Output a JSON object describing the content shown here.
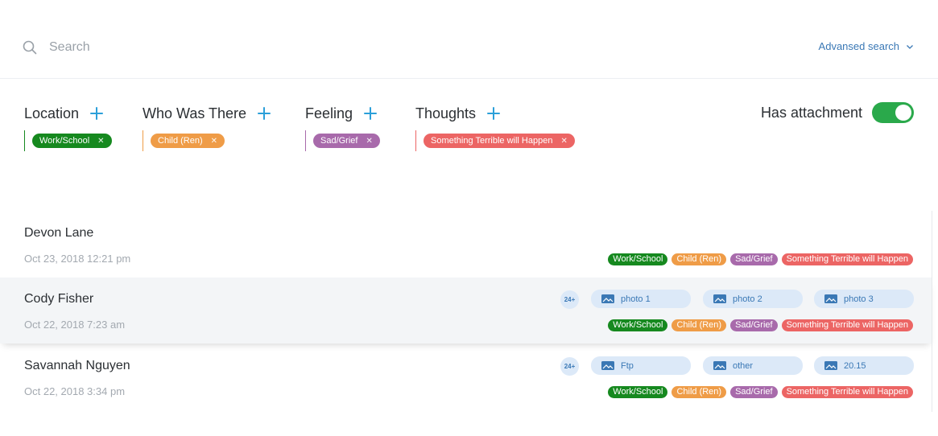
{
  "search": {
    "placeholder": "Search",
    "advanced_label": "Advansed search"
  },
  "filters": [
    {
      "title": "Location",
      "chip": "Work/School"
    },
    {
      "title": "Who Was There",
      "chip": "Child (Ren)"
    },
    {
      "title": "Feeling",
      "chip": "Sad/Grief"
    },
    {
      "title": "Thoughts",
      "chip": "Something Terrible will Happen"
    }
  ],
  "has_attachment": {
    "label": "Has attachment",
    "on": true
  },
  "entries": [
    {
      "name": "Devon Lane",
      "date": "Oct 23, 2018 12:21 pm",
      "tags": [
        "Work/School",
        "Child (Ren)",
        "Sad/Grief",
        "Something Terrible will Happen"
      ]
    },
    {
      "name": "Cody Fisher",
      "date": "Oct 22, 2018 7:23 am",
      "count": "24+",
      "attachments": [
        "photo 1",
        "photo 2",
        "photo 3"
      ],
      "tags": [
        "Work/School",
        "Child (Ren)",
        "Sad/Grief",
        "Something Terrible will Happen"
      ]
    },
    {
      "name": "Savannah Nguyen",
      "date": "Oct 22, 2018 3:34 pm",
      "count": "24+",
      "attachments": [
        "Ftp",
        "other",
        "20.15"
      ],
      "tags": [
        "Work/School",
        "Child (Ren)",
        "Sad/Grief",
        "Something Terrible will Happen"
      ]
    }
  ],
  "colors": {
    "location": "#16891f",
    "who": "#ef9c47",
    "feeling": "#a86aab",
    "thoughts": "#ec6564",
    "accent": "#2b9fd9",
    "toggle_on": "#2aa94b",
    "link": "#3a78b5"
  },
  "icons": [
    "search-icon",
    "chevron-down-icon",
    "plus-icon",
    "close-icon",
    "image-icon"
  ]
}
